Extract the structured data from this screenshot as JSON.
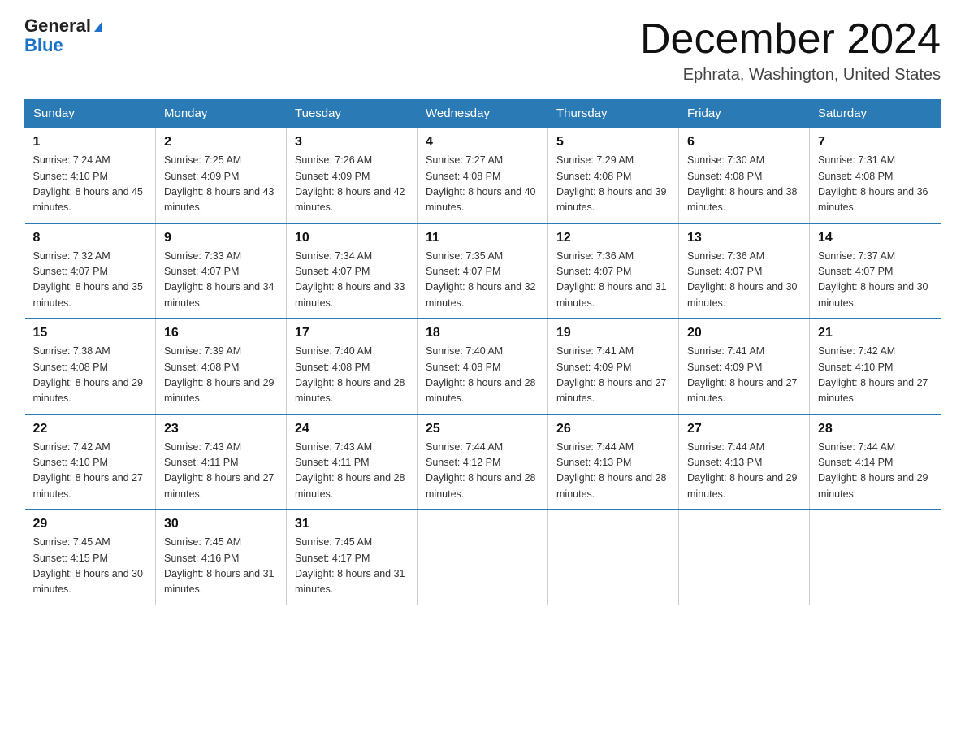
{
  "logo": {
    "text_general": "General",
    "text_blue": "Blue"
  },
  "title": "December 2024",
  "location": "Ephrata, Washington, United States",
  "weekdays": [
    "Sunday",
    "Monday",
    "Tuesday",
    "Wednesday",
    "Thursday",
    "Friday",
    "Saturday"
  ],
  "weeks": [
    [
      {
        "day": "1",
        "sunrise": "7:24 AM",
        "sunset": "4:10 PM",
        "daylight": "8 hours and 45 minutes."
      },
      {
        "day": "2",
        "sunrise": "7:25 AM",
        "sunset": "4:09 PM",
        "daylight": "8 hours and 43 minutes."
      },
      {
        "day": "3",
        "sunrise": "7:26 AM",
        "sunset": "4:09 PM",
        "daylight": "8 hours and 42 minutes."
      },
      {
        "day": "4",
        "sunrise": "7:27 AM",
        "sunset": "4:08 PM",
        "daylight": "8 hours and 40 minutes."
      },
      {
        "day": "5",
        "sunrise": "7:29 AM",
        "sunset": "4:08 PM",
        "daylight": "8 hours and 39 minutes."
      },
      {
        "day": "6",
        "sunrise": "7:30 AM",
        "sunset": "4:08 PM",
        "daylight": "8 hours and 38 minutes."
      },
      {
        "day": "7",
        "sunrise": "7:31 AM",
        "sunset": "4:08 PM",
        "daylight": "8 hours and 36 minutes."
      }
    ],
    [
      {
        "day": "8",
        "sunrise": "7:32 AM",
        "sunset": "4:07 PM",
        "daylight": "8 hours and 35 minutes."
      },
      {
        "day": "9",
        "sunrise": "7:33 AM",
        "sunset": "4:07 PM",
        "daylight": "8 hours and 34 minutes."
      },
      {
        "day": "10",
        "sunrise": "7:34 AM",
        "sunset": "4:07 PM",
        "daylight": "8 hours and 33 minutes."
      },
      {
        "day": "11",
        "sunrise": "7:35 AM",
        "sunset": "4:07 PM",
        "daylight": "8 hours and 32 minutes."
      },
      {
        "day": "12",
        "sunrise": "7:36 AM",
        "sunset": "4:07 PM",
        "daylight": "8 hours and 31 minutes."
      },
      {
        "day": "13",
        "sunrise": "7:36 AM",
        "sunset": "4:07 PM",
        "daylight": "8 hours and 30 minutes."
      },
      {
        "day": "14",
        "sunrise": "7:37 AM",
        "sunset": "4:07 PM",
        "daylight": "8 hours and 30 minutes."
      }
    ],
    [
      {
        "day": "15",
        "sunrise": "7:38 AM",
        "sunset": "4:08 PM",
        "daylight": "8 hours and 29 minutes."
      },
      {
        "day": "16",
        "sunrise": "7:39 AM",
        "sunset": "4:08 PM",
        "daylight": "8 hours and 29 minutes."
      },
      {
        "day": "17",
        "sunrise": "7:40 AM",
        "sunset": "4:08 PM",
        "daylight": "8 hours and 28 minutes."
      },
      {
        "day": "18",
        "sunrise": "7:40 AM",
        "sunset": "4:08 PM",
        "daylight": "8 hours and 28 minutes."
      },
      {
        "day": "19",
        "sunrise": "7:41 AM",
        "sunset": "4:09 PM",
        "daylight": "8 hours and 27 minutes."
      },
      {
        "day": "20",
        "sunrise": "7:41 AM",
        "sunset": "4:09 PM",
        "daylight": "8 hours and 27 minutes."
      },
      {
        "day": "21",
        "sunrise": "7:42 AM",
        "sunset": "4:10 PM",
        "daylight": "8 hours and 27 minutes."
      }
    ],
    [
      {
        "day": "22",
        "sunrise": "7:42 AM",
        "sunset": "4:10 PM",
        "daylight": "8 hours and 27 minutes."
      },
      {
        "day": "23",
        "sunrise": "7:43 AM",
        "sunset": "4:11 PM",
        "daylight": "8 hours and 27 minutes."
      },
      {
        "day": "24",
        "sunrise": "7:43 AM",
        "sunset": "4:11 PM",
        "daylight": "8 hours and 28 minutes."
      },
      {
        "day": "25",
        "sunrise": "7:44 AM",
        "sunset": "4:12 PM",
        "daylight": "8 hours and 28 minutes."
      },
      {
        "day": "26",
        "sunrise": "7:44 AM",
        "sunset": "4:13 PM",
        "daylight": "8 hours and 28 minutes."
      },
      {
        "day": "27",
        "sunrise": "7:44 AM",
        "sunset": "4:13 PM",
        "daylight": "8 hours and 29 minutes."
      },
      {
        "day": "28",
        "sunrise": "7:44 AM",
        "sunset": "4:14 PM",
        "daylight": "8 hours and 29 minutes."
      }
    ],
    [
      {
        "day": "29",
        "sunrise": "7:45 AM",
        "sunset": "4:15 PM",
        "daylight": "8 hours and 30 minutes."
      },
      {
        "day": "30",
        "sunrise": "7:45 AM",
        "sunset": "4:16 PM",
        "daylight": "8 hours and 31 minutes."
      },
      {
        "day": "31",
        "sunrise": "7:45 AM",
        "sunset": "4:17 PM",
        "daylight": "8 hours and 31 minutes."
      },
      null,
      null,
      null,
      null
    ]
  ]
}
